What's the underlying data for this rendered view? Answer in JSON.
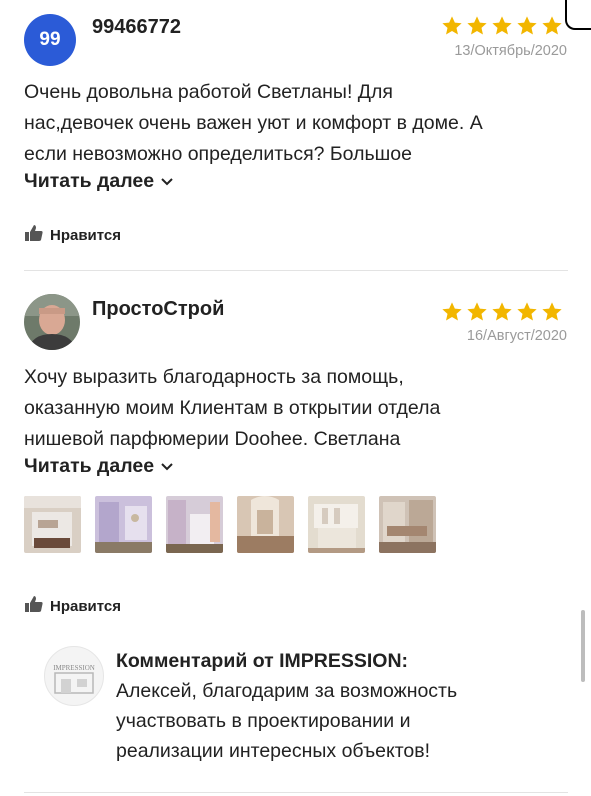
{
  "reviews": [
    {
      "avatar_text": "99",
      "author": "99466772",
      "rating": 5,
      "date": "13/Октябрь/2020",
      "text_lines": [
        "Очень довольна работой Светланы! Для",
        "нас,девочек очень важен уют и комфорт в доме. А",
        "если невозможно определиться? Большое"
      ],
      "read_more": "Читать далее",
      "like_label": "Нравится"
    },
    {
      "author": "ПростоСтрой",
      "rating": 5,
      "date": "16/Август/2020",
      "text_lines": [
        "Хочу выразить благодарность за помощь,",
        "оказанную моим Клиентам в открытии отдела",
        "нишевой парфюмерии Doohee. Светлана"
      ],
      "read_more": "Читать далее",
      "photos_count": 6,
      "like_label": "Нравится",
      "reply": {
        "logo_text": "IMPRESSION",
        "title": "Комментарий от IMPRESSION:",
        "lines": [
          "Алексей, благодарим за возможность",
          "участвовать в проектировании и",
          "реализации интересных объектов!"
        ]
      }
    }
  ],
  "colors": {
    "star": "#f2b600",
    "avatar_bg": "#2b5bd7",
    "muted": "#9a9a9a"
  }
}
